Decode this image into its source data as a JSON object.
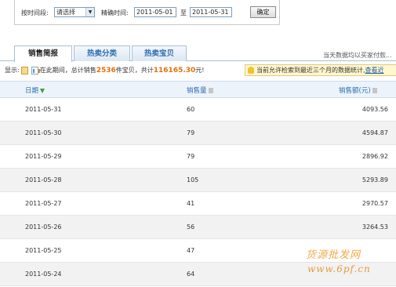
{
  "filter": {
    "time_period_label": "按时间段:",
    "select_value": "请选择",
    "exact_time_label": "精确时间:",
    "start_date": "2011-05-01",
    "to_label": "至",
    "end_date": "2011-05-31",
    "confirm_label": "确定"
  },
  "tabs": [
    {
      "label": "销售简报",
      "active": true
    },
    {
      "label": "热卖分类",
      "active": false
    },
    {
      "label": "热卖宝贝",
      "active": false
    }
  ],
  "right_note": "当天数据均以买家付款...",
  "summary": {
    "display_label": "显示:",
    "prefix": "在此期间，总计销售",
    "count": "2536",
    "middle": "件宝贝，共计",
    "amount": "116165.30",
    "suffix": "元!"
  },
  "notice": {
    "text": "当前允许检索到最近三个月的数据统计,",
    "link": "查看近"
  },
  "table": {
    "headers": {
      "date": "日期",
      "qty": "销售量",
      "amount": "销售额(元)"
    },
    "rows": [
      {
        "date": "2011-05-31",
        "qty": "60",
        "amount": "4093.56"
      },
      {
        "date": "2011-05-30",
        "qty": "79",
        "amount": "4594.87"
      },
      {
        "date": "2011-05-29",
        "qty": "79",
        "amount": "2896.92"
      },
      {
        "date": "2011-05-28",
        "qty": "105",
        "amount": "5293.89"
      },
      {
        "date": "2011-05-27",
        "qty": "41",
        "amount": "2970.57"
      },
      {
        "date": "2011-05-26",
        "qty": "56",
        "amount": "3264.53"
      },
      {
        "date": "2011-05-25",
        "qty": "47",
        "amount": ""
      },
      {
        "date": "2011-05-24",
        "qty": "64",
        "amount": ""
      }
    ]
  },
  "watermark": {
    "line1": "货源批发网",
    "line2": "www.6pf.cn"
  }
}
